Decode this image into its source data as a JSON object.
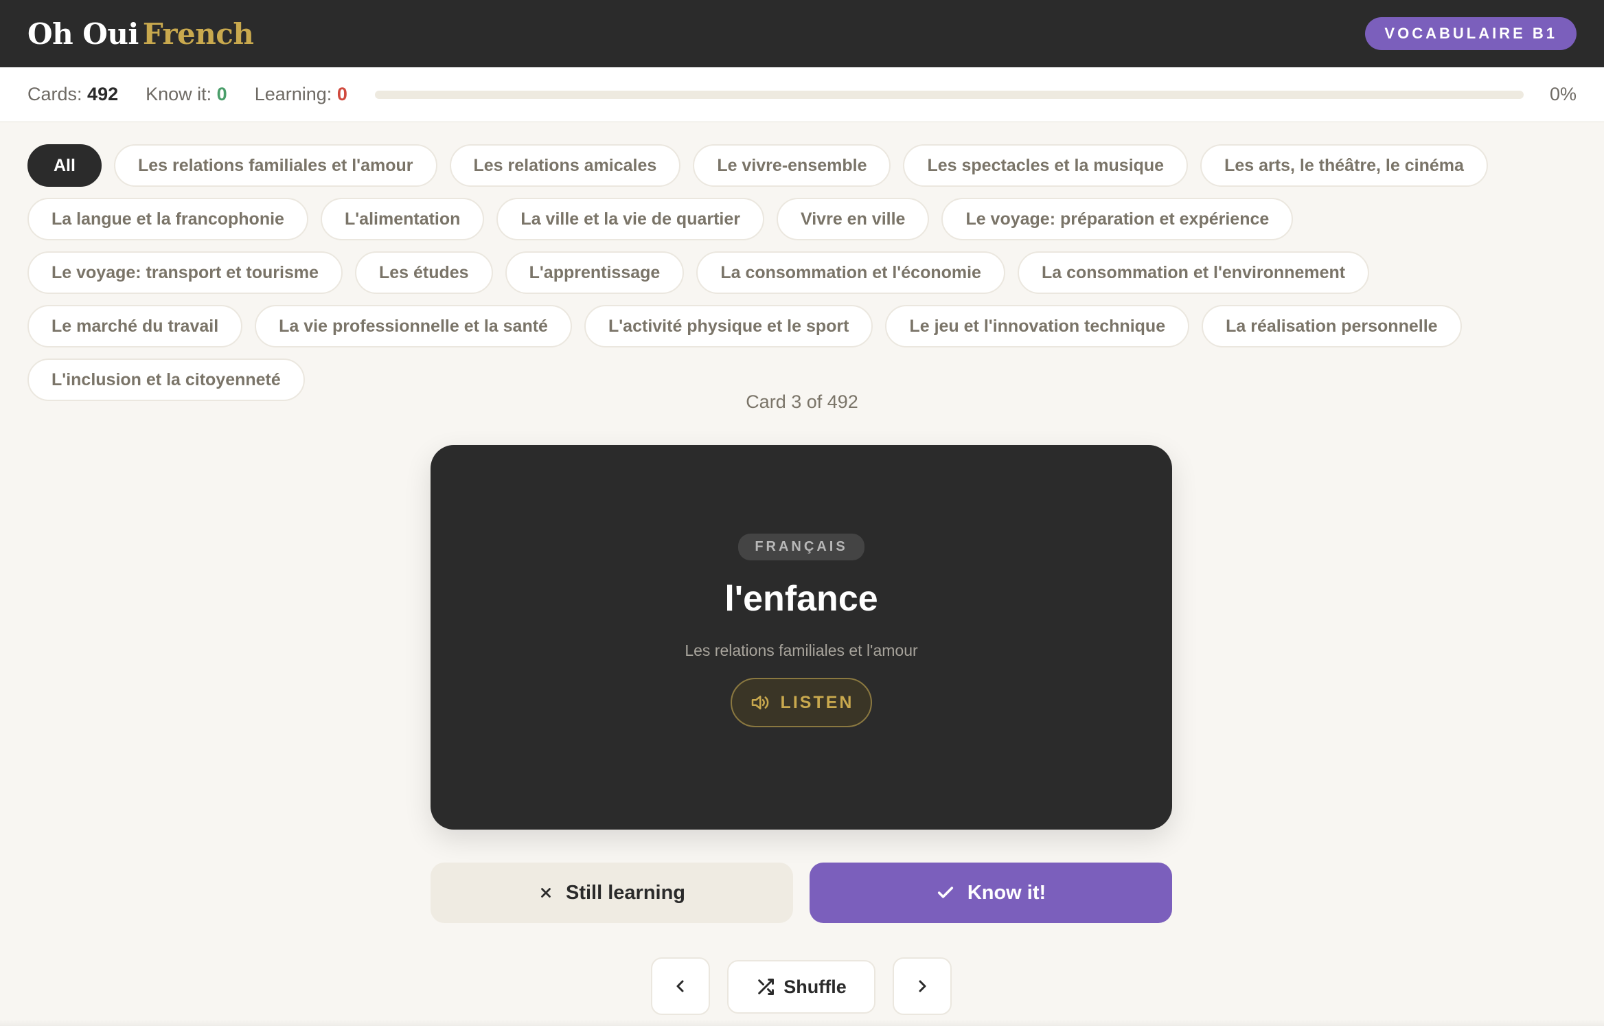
{
  "header": {
    "brand_part1": "Oh Oui",
    "brand_part2": "French",
    "level_badge": "VOCABULAIRE B1"
  },
  "stats": {
    "cards_label": "Cards:",
    "cards_value": "492",
    "know_label": "Know it:",
    "know_value": "0",
    "learning_label": "Learning:",
    "learning_value": "0",
    "progress_percent": "0%",
    "progress_fraction": 0
  },
  "filters": [
    "All",
    "Les relations familiales et l'amour",
    "Les relations amicales",
    "Le vivre-ensemble",
    "Les spectacles et la musique",
    "Les arts, le théâtre, le cinéma",
    "La langue et la francophonie",
    "L'alimentation",
    "La ville et la vie de quartier",
    "Vivre en ville",
    "Le voyage: préparation et expérience",
    "Le voyage: transport et tourisme",
    "Les études",
    "L'apprentissage",
    "La consommation et l'économie",
    "La consommation et l'environnement",
    "Le marché du travail",
    "La vie professionnelle et la santé",
    "L'activité physique et le sport",
    "Le jeu et l'innovation technique",
    "La réalisation personnelle",
    "L'inclusion et la citoyenneté"
  ],
  "active_filter": "All",
  "counter": "Card 3 of 492",
  "card": {
    "language": "FRANÇAIS",
    "word": "l'enfance",
    "category": "Les relations familiales et l'amour",
    "listen_label": "LISTEN",
    "listen_icon": "speaker-icon"
  },
  "actions": {
    "still_learning": "Still learning",
    "still_learning_icon": "x-icon",
    "know_it": "Know it!",
    "know_it_icon": "check-icon"
  },
  "nav": {
    "prev_icon": "chevron-left-icon",
    "shuffle_label": "Shuffle",
    "shuffle_icon": "shuffle-icon",
    "next_icon": "chevron-right-icon"
  },
  "colors": {
    "accent": "#7b5fbc",
    "gold": "#c9a94e",
    "dark": "#2b2b2b",
    "know_green": "#4a9e6a",
    "learning_red": "#d04a3e"
  }
}
